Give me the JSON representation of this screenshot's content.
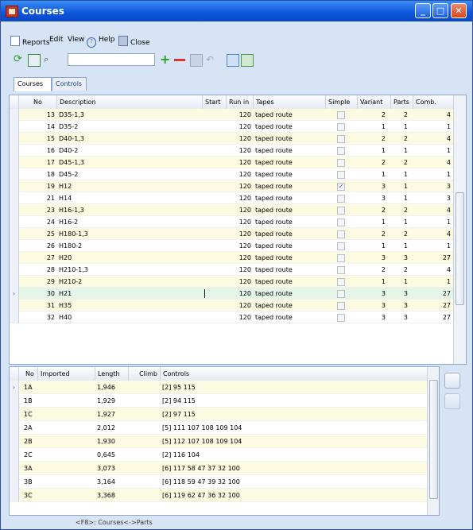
{
  "window": {
    "title": "Courses"
  },
  "menu": [
    {
      "label": "Reports",
      "icon": "report-icon"
    },
    {
      "label": "Edit"
    },
    {
      "label": "View"
    },
    {
      "label": "Help",
      "icon": "help-icon"
    },
    {
      "label": "Close",
      "icon": "close-doc-icon"
    }
  ],
  "toolbar": {
    "search_value": ""
  },
  "tabs": [
    {
      "label": "Courses"
    },
    {
      "label": "Controls"
    }
  ],
  "courses": {
    "columns": [
      "No",
      "Description",
      "Start",
      "Run in",
      "Tapes",
      "Simple",
      "Variant",
      "Parts",
      "Comb."
    ],
    "rows": [
      {
        "no": "13",
        "desc": "D35-1,3",
        "start": "",
        "runin": "120",
        "tapes": "taped route",
        "simple": false,
        "variant": "2",
        "parts": "2",
        "comb": "4"
      },
      {
        "no": "14",
        "desc": "D35-2",
        "start": "",
        "runin": "120",
        "tapes": "taped route",
        "simple": false,
        "variant": "1",
        "parts": "1",
        "comb": "1"
      },
      {
        "no": "15",
        "desc": "D40-1,3",
        "start": "",
        "runin": "120",
        "tapes": "taped route",
        "simple": false,
        "variant": "2",
        "parts": "2",
        "comb": "4"
      },
      {
        "no": "16",
        "desc": "D40-2",
        "start": "",
        "runin": "120",
        "tapes": "taped route",
        "simple": false,
        "variant": "1",
        "parts": "1",
        "comb": "1"
      },
      {
        "no": "17",
        "desc": "D45-1,3",
        "start": "",
        "runin": "120",
        "tapes": "taped route",
        "simple": false,
        "variant": "2",
        "parts": "2",
        "comb": "4"
      },
      {
        "no": "18",
        "desc": "D45-2",
        "start": "",
        "runin": "120",
        "tapes": "taped route",
        "simple": false,
        "variant": "1",
        "parts": "1",
        "comb": "1"
      },
      {
        "no": "19",
        "desc": "H12",
        "start": "",
        "runin": "120",
        "tapes": "taped route",
        "simple": true,
        "variant": "3",
        "parts": "1",
        "comb": "3"
      },
      {
        "no": "21",
        "desc": "H14",
        "start": "",
        "runin": "120",
        "tapes": "taped route",
        "simple": false,
        "variant": "3",
        "parts": "1",
        "comb": "3"
      },
      {
        "no": "23",
        "desc": "H16-1,3",
        "start": "",
        "runin": "120",
        "tapes": "taped route",
        "simple": false,
        "variant": "2",
        "parts": "2",
        "comb": "4"
      },
      {
        "no": "24",
        "desc": "H16-2",
        "start": "",
        "runin": "120",
        "tapes": "taped route",
        "simple": false,
        "variant": "1",
        "parts": "1",
        "comb": "1"
      },
      {
        "no": "25",
        "desc": "H180-1,3",
        "start": "",
        "runin": "120",
        "tapes": "taped route",
        "simple": false,
        "variant": "2",
        "parts": "2",
        "comb": "4"
      },
      {
        "no": "26",
        "desc": "H180-2",
        "start": "",
        "runin": "120",
        "tapes": "taped route",
        "simple": false,
        "variant": "1",
        "parts": "1",
        "comb": "1"
      },
      {
        "no": "27",
        "desc": "H20",
        "start": "",
        "runin": "120",
        "tapes": "taped route",
        "simple": false,
        "variant": "3",
        "parts": "3",
        "comb": "27"
      },
      {
        "no": "28",
        "desc": "H210-1,3",
        "start": "",
        "runin": "120",
        "tapes": "taped route",
        "simple": false,
        "variant": "2",
        "parts": "2",
        "comb": "4"
      },
      {
        "no": "29",
        "desc": "H210-2",
        "start": "",
        "runin": "120",
        "tapes": "taped route",
        "simple": false,
        "variant": "1",
        "parts": "1",
        "comb": "1"
      },
      {
        "no": "30",
        "desc": "H21",
        "start": "",
        "runin": "120",
        "tapes": "taped route",
        "simple": false,
        "variant": "3",
        "parts": "3",
        "comb": "27",
        "selected": true
      },
      {
        "no": "31",
        "desc": "H35",
        "start": "",
        "runin": "120",
        "tapes": "taped route",
        "simple": false,
        "variant": "3",
        "parts": "3",
        "comb": "27"
      },
      {
        "no": "32",
        "desc": "H40",
        "start": "",
        "runin": "120",
        "tapes": "taped route",
        "simple": false,
        "variant": "3",
        "parts": "3",
        "comb": "27"
      }
    ]
  },
  "variants": {
    "columns": [
      "No",
      "Imported",
      "Length",
      "Climb",
      "Controls"
    ],
    "rows": [
      {
        "no": "1A",
        "imported": "",
        "length": "1,946",
        "climb": "",
        "controls": "[2] 95 115"
      },
      {
        "no": "1B",
        "imported": "",
        "length": "1,929",
        "climb": "",
        "controls": "[2] 94 115"
      },
      {
        "no": "1C",
        "imported": "",
        "length": "1,927",
        "climb": "",
        "controls": "[2] 97 115"
      },
      {
        "no": "2A",
        "imported": "",
        "length": "2,012",
        "climb": "",
        "controls": "[5] 111 107 108 109 104"
      },
      {
        "no": "2B",
        "imported": "",
        "length": "1,930",
        "climb": "",
        "controls": "[5] 112 107 108 109 104"
      },
      {
        "no": "2C",
        "imported": "",
        "length": "0,645",
        "climb": "",
        "controls": "[2] 116 104"
      },
      {
        "no": "3A",
        "imported": "",
        "length": "3,073",
        "climb": "",
        "controls": "[6] 117 58 47 37 32 100"
      },
      {
        "no": "3B",
        "imported": "",
        "length": "3,164",
        "climb": "",
        "controls": "[6] 118 59 47 39 32 100"
      },
      {
        "no": "3C",
        "imported": "",
        "length": "3,368",
        "climb": "",
        "controls": "[6] 119 62 47 36 32 100"
      }
    ]
  },
  "status": {
    "text": "<F8>: Courses<->Parts"
  },
  "colors": {
    "title": "#0b55db",
    "odd_row": "#fcfae0",
    "selected_row": "#e5f6e8"
  }
}
